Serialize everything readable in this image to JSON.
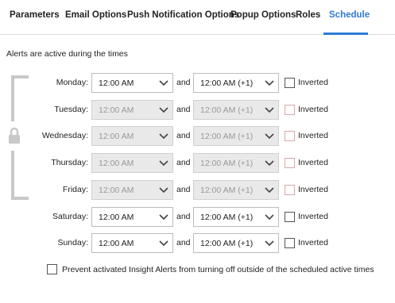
{
  "tabs": [
    {
      "label": "Parameters",
      "active": false
    },
    {
      "label": "Email Options",
      "active": false
    },
    {
      "label": "Push Notification Options",
      "active": false
    },
    {
      "label": "Popup Options",
      "active": false
    },
    {
      "label": "Roles",
      "active": false
    },
    {
      "label": "Schedule",
      "active": true
    }
  ],
  "intro_text": "Alerts are active during the times",
  "and_label": "and",
  "inverted_label": "Inverted",
  "days": [
    {
      "label": "Monday:",
      "start": "12:00 AM",
      "end": "12:00 AM (+1)",
      "enabled": true,
      "inverted": false
    },
    {
      "label": "Tuesday:",
      "start": "12:00 AM",
      "end": "12:00 AM (+1)",
      "enabled": false,
      "inverted": false
    },
    {
      "label": "Wednesday:",
      "start": "12:00 AM",
      "end": "12:00 AM (+1)",
      "enabled": false,
      "inverted": false
    },
    {
      "label": "Thursday:",
      "start": "12:00 AM",
      "end": "12:00 AM (+1)",
      "enabled": false,
      "inverted": false
    },
    {
      "label": "Friday:",
      "start": "12:00 AM",
      "end": "12:00 AM (+1)",
      "enabled": false,
      "inverted": false
    },
    {
      "label": "Saturday:",
      "start": "12:00 AM",
      "end": "12:00 AM (+1)",
      "enabled": true,
      "inverted": false
    },
    {
      "label": "Sunday:",
      "start": "12:00 AM",
      "end": "12:00 AM (+1)",
      "enabled": true,
      "inverted": false
    }
  ],
  "prevent_option": {
    "label": "Prevent activated Insight Alerts from turning off outside of the scheduled active times",
    "checked": false
  },
  "colors": {
    "accent": "#2e7bd6",
    "disabled_bg": "#e9e9e9",
    "disabled_text": "#999999",
    "bracket": "#c8c8c8"
  },
  "icons": {
    "lock": "lock-icon",
    "chevron": "chevron-down-icon"
  }
}
